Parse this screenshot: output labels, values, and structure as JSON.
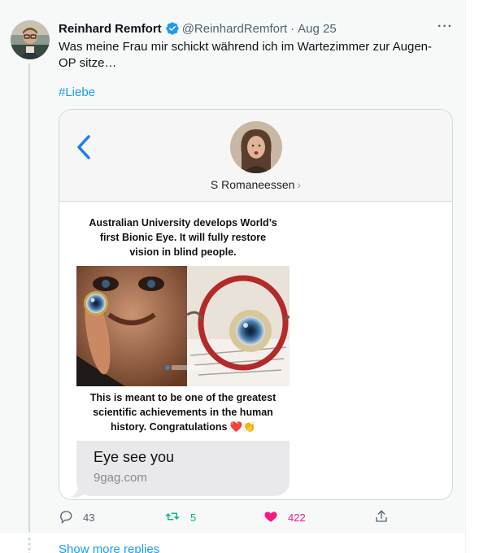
{
  "tweet": {
    "author_name": "Reinhard Remfort",
    "handle": "@ReinhardRemfort",
    "separator": "·",
    "date": "Aug 25",
    "more_label": "···",
    "text": "Was meine Frau mir schickt während ich im Wartezimmer zur Augen-OP sitze…",
    "hashtag": "#Liebe"
  },
  "media": {
    "contact_name": "S Romaneessen",
    "contact_chevron": "›",
    "meme_top_text": "Australian University develops World’s first Bionic Eye. It will fully restore vision in blind people.",
    "meme_bottom_text": "This is meant to be one of the greatest scientific achievements in the human history. Congratulations ❤️👏",
    "link_title": "Eye see you",
    "link_domain": "9gag.com"
  },
  "actions": {
    "reply_count": "43",
    "retweet_count": "5",
    "like_count": "422"
  },
  "footer": {
    "show_more": "Show more replies"
  },
  "colors": {
    "accent": "#1d9bf0",
    "retweet": "#00ba7c",
    "like": "#f91880",
    "muted": "#536471",
    "ios_blue": "#1a7cf5"
  }
}
